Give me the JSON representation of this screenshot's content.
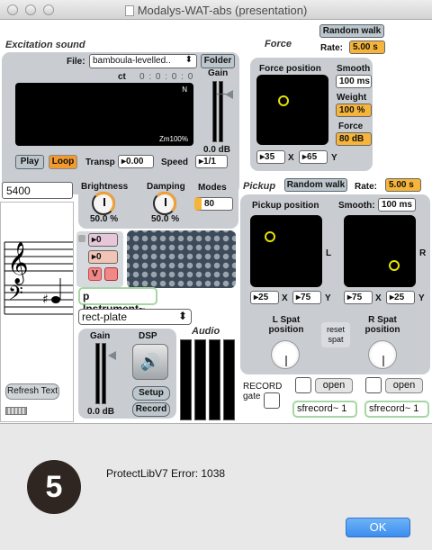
{
  "window": {
    "title": "Modalys-WAT-abs (presentation)"
  },
  "excitation": {
    "title": "Excitation sound",
    "file_label": "File:",
    "file_value": "bamboula-levelled..",
    "folder_btn": "Folder",
    "ct_label": "ct",
    "ct_value": "0 : 0 : 0 : 0",
    "display_corner": "N",
    "zoom": "Zm100%",
    "gain_label": "Gain",
    "gain_value": "0.0 dB",
    "play_btn": "Play",
    "loop_btn": "Loop",
    "transp_label": "Transp",
    "transp_value": "0.00",
    "speed_label": "Speed",
    "speed_value": "1/1"
  },
  "force": {
    "title": "Force",
    "random_walk_btn": "Random walk",
    "rate_label": "Rate:",
    "rate_value": "5.00 s",
    "position_label": "Force position",
    "smooth_label": "Smooth",
    "smooth_value": "100 ms",
    "weight_label": "Weight",
    "weight_value": "100 %",
    "force_label": "Force",
    "force_value": "80 dB",
    "x_value": "35",
    "x_label": "X",
    "y_value": "65",
    "y_label": "Y"
  },
  "left": {
    "number_value": "5400",
    "refresh_btn": "Refresh Text"
  },
  "tone": {
    "brightness_label": "Brightness",
    "brightness_value": "50.0 %",
    "damping_label": "Damping",
    "damping_value": "50.0 %",
    "modes_label": "Modes",
    "modes_value": "80"
  },
  "instrument": {
    "num1": "0",
    "num2": "0",
    "v_btn": "V",
    "object_name": "p Instrument~",
    "menu_value": "rect-plate"
  },
  "audio": {
    "gain_label": "Gain",
    "gain_value": "0.0 dB",
    "dsp_label": "DSP",
    "setup_btn": "Setup",
    "record_btn": "Record",
    "audio_label": "Audio"
  },
  "pickup": {
    "title": "Pickup",
    "random_walk_btn": "Random walk",
    "rate_label": "Rate:",
    "rate_value": "5.00 s",
    "position_label": "Pickup position",
    "smooth_label": "Smooth:",
    "smooth_value": "100 ms",
    "l_label": "L",
    "r_label": "R",
    "lx_value": "25",
    "lx_label": "X",
    "ly_value": "75",
    "ly_label": "Y",
    "rx_value": "75",
    "rx_label": "X",
    "ry_value": "25",
    "ry_label": "Y",
    "l_spat_label": "L Spat\nposition",
    "reset_spat_label": "reset\nspat",
    "r_spat_label": "R Spat\nposition"
  },
  "record": {
    "gate_label": "RECORD\ngate",
    "open1_btn": "open",
    "open2_btn": "open",
    "sfrecord1": "sfrecord~ 1",
    "sfrecord2": "sfrecord~ 1"
  },
  "dialog": {
    "icon_number": "5",
    "message": "ProtectLibV7 Error: 1038",
    "ok_btn": "OK"
  },
  "colors": {
    "accent_orange": "#f6b53a",
    "panel_gray": "#c9cdd2",
    "pad_black": "#000000",
    "cursor_yellow": "#e5e200",
    "ok_blue": "#3b8df0"
  }
}
